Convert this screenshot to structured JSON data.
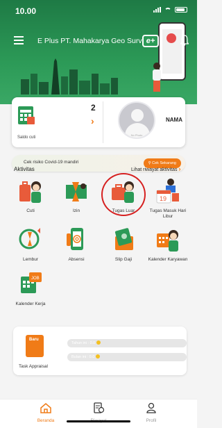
{
  "status_bar": {
    "time": "10.00"
  },
  "header": {
    "company": "E Plus PT. Mahakarya Geo Surv",
    "logo_text": "e+"
  },
  "profile_card": {
    "saldo_count": "2",
    "saldo_label": "Saldo cuti",
    "avatar_caption": "No Photo",
    "name": "NAMA"
  },
  "covid_banner": {
    "text": "Cek risiko Covid-19 mandiri",
    "button": "Cek Sekarang"
  },
  "activity": {
    "title": "Aktivitas",
    "history_link": "Lihat riwayat aktivitas",
    "items": [
      {
        "label": "Cuti",
        "icon": "luggage-person-icon"
      },
      {
        "label": "Izin",
        "icon": "hourglass-person-icon"
      },
      {
        "label": "Tugas Luar",
        "icon": "briefcase-person-icon"
      },
      {
        "label": "Tugas Masuk Hari Libur",
        "icon": "calendar-person-icon"
      },
      {
        "label": "Lembur",
        "icon": "overtime-clock-icon"
      },
      {
        "label": "Absensi",
        "icon": "fingerprint-phone-icon"
      },
      {
        "label": "Slip Gaji",
        "icon": "payslip-icon"
      },
      {
        "label": "Kalender Karyawan",
        "icon": "calendar-employee-icon"
      },
      {
        "label": "Kalender Kerja",
        "icon": "job-calendar-icon"
      }
    ]
  },
  "appraisal": {
    "badge": "Baru",
    "label": "Task Appraisal",
    "year_text": "Tahun ini : 0.0",
    "month_text": "Bulan ini : 0.0"
  },
  "bottom_nav": {
    "items": [
      {
        "label": "Beranda",
        "icon": "home-icon",
        "active": true
      },
      {
        "label": "Riwayat",
        "icon": "history-document-icon",
        "active": false
      },
      {
        "label": "Profil",
        "icon": "profile-icon",
        "active": false
      }
    ]
  },
  "colors": {
    "brand_green": "#2c9a57",
    "accent_orange": "#f07b17",
    "highlight_red": "#d62020"
  }
}
